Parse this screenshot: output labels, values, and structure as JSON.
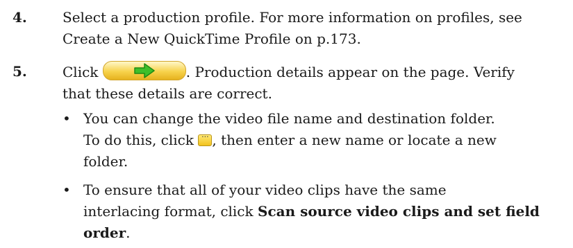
{
  "steps": [
    {
      "number": "4.",
      "lines": [
        "Select a production profile. For more information on profiles, see",
        "Create a New QuickTime Profile on p.173."
      ]
    },
    {
      "number": "5.",
      "click_text": "Click",
      "after_button_text": ". Production details appear on the page. Verify",
      "line2": "that these details are correct.",
      "bullets": [
        {
          "lines": [
            "You can change the video file name and destination folder.",
            "To do this, click",
            ", then enter a new name or locate a new",
            "folder."
          ]
        },
        {
          "lines": [
            "To ensure that all of your video clips have the same",
            "interlacing format, click ",
            "Scan source video clips and set field",
            "order",
            "."
          ]
        }
      ]
    }
  ],
  "icons": {
    "next_button": "green-arrow-icon",
    "browse_button": "ellipsis-icon"
  },
  "browse_glyph": "...",
  "bullet_glyph": "•"
}
